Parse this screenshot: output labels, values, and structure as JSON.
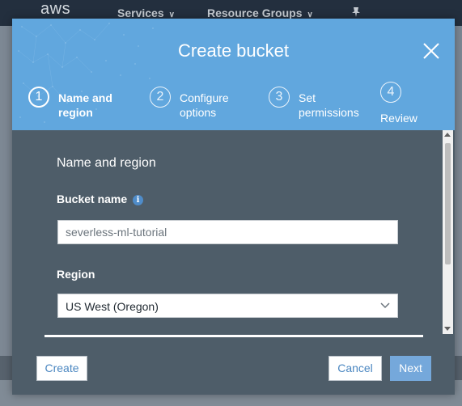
{
  "background": {
    "logo": "aws",
    "nav": [
      {
        "label": "Services"
      },
      {
        "label": "Resource Groups"
      }
    ]
  },
  "modal": {
    "title": "Create bucket",
    "steps": [
      {
        "number": "1",
        "label": "Name and region",
        "active": true
      },
      {
        "number": "2",
        "label": "Configure options",
        "active": false
      },
      {
        "number": "3",
        "label": "Set permissions",
        "active": false
      },
      {
        "number": "4",
        "label": "Review",
        "active": false
      }
    ],
    "section_title": "Name and region",
    "bucket_name": {
      "label": "Bucket name",
      "value": "severless-ml-tutorial"
    },
    "region": {
      "label": "Region",
      "value": "US West (Oregon)"
    },
    "buttons": {
      "create": "Create",
      "cancel": "Cancel",
      "next": "Next"
    }
  },
  "colors": {
    "header_blue": "#61a7de",
    "modal_body": "#4e5d69",
    "link_blue": "#4b87c1",
    "primary_button": "#75a8db"
  }
}
